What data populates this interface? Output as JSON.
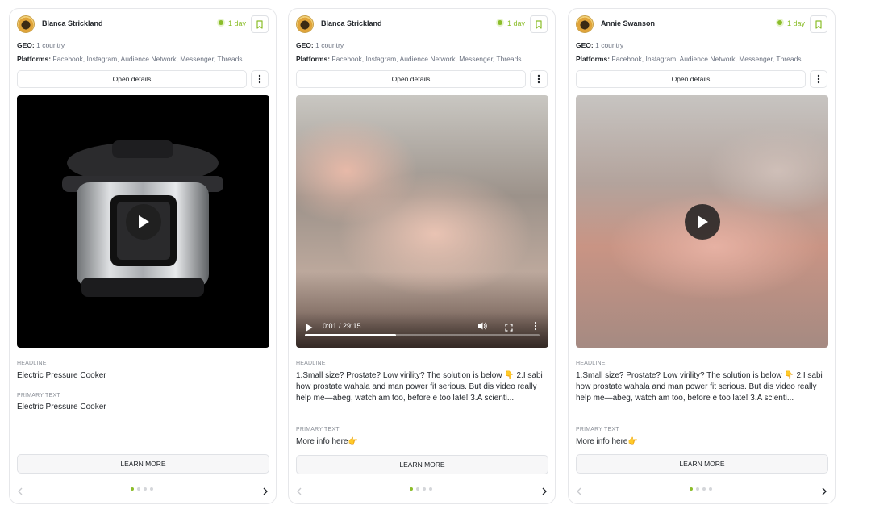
{
  "cards": [
    {
      "advertiser": "Blanca Strickland",
      "activity": "1 day",
      "geo_label": "GEO:",
      "geo_value": "1 country",
      "platforms_label": "Platforms:",
      "platforms_value": "Facebook, Instagram, Audience Network, Messenger, Threads",
      "open_details": "Open details",
      "headline_label": "HEADLINE",
      "headline": "Electric Pressure Cooker",
      "primary_label": "PRIMARY TEXT",
      "primary_text": "Electric Pressure Cooker",
      "cta": "LEARN MORE"
    },
    {
      "advertiser": "Blanca Strickland",
      "activity": "1 day",
      "geo_label": "GEO:",
      "geo_value": "1 country",
      "platforms_label": "Platforms:",
      "platforms_value": "Facebook, Instagram, Audience Network, Messenger, Threads",
      "open_details": "Open details",
      "video_time": "0:01 / 29:15",
      "video_progress": 0.39,
      "headline_label": "HEADLINE",
      "headline": "1.Small size? Prostate? Low virility? The solution is below 👇 2.I sabi how prostate wahala and man power fit serious. But dis video really help me—abeg, watch am too, before e too late! 3.A scienti...",
      "primary_label": "PRIMARY TEXT",
      "primary_text": "More info here👉",
      "cta": "LEARN MORE"
    },
    {
      "advertiser": "Annie Swanson",
      "activity": "1 day",
      "geo_label": "GEO:",
      "geo_value": "1 country",
      "platforms_label": "Platforms:",
      "platforms_value": "Facebook, Instagram, Audience Network, Messenger, Threads",
      "open_details": "Open details",
      "headline_label": "HEADLINE",
      "headline": "1.Small size? Prostate? Low virility? The solution is below 👇 2.I sabi how prostate wahala and man power fit serious. But dis video really help me—abeg, watch am too, before e too late! 3.A scienti...",
      "primary_label": "PRIMARY TEXT",
      "primary_text": "More info here👉",
      "cta": "LEARN MORE"
    }
  ],
  "colors": {
    "accent": "#8bbd2a",
    "border": "#e6e7ea",
    "muted": "#6b7280"
  },
  "icons": [
    "bookmark-icon",
    "more-vertical-icon",
    "play-icon",
    "volume-icon",
    "fullscreen-icon",
    "chevron-left-icon",
    "chevron-right-icon"
  ]
}
